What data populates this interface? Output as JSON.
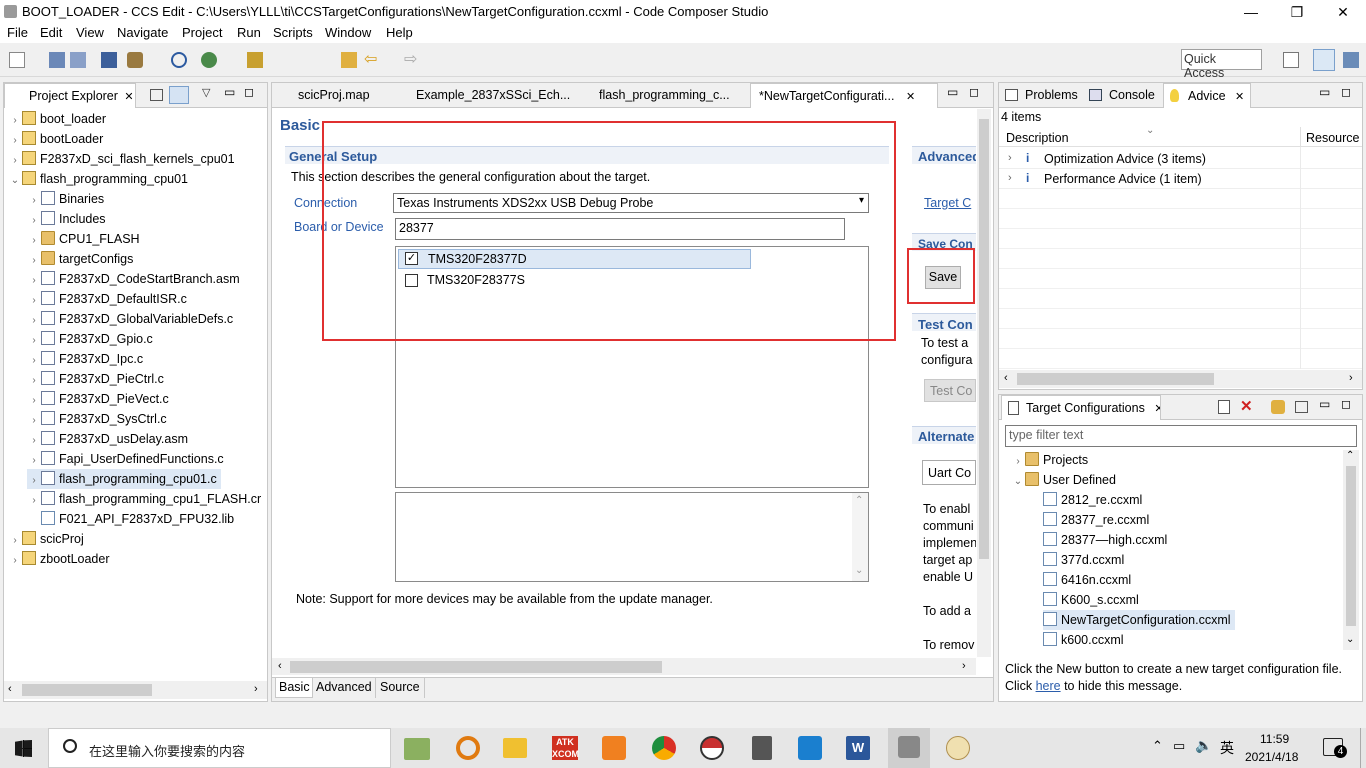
{
  "window": {
    "title": "BOOT_LOADER - CCS Edit - C:\\Users\\YLLL\\ti\\CCSTargetConfigurations\\NewTargetConfiguration.ccxml - Code Composer Studio",
    "minimize": "—",
    "restore": "❐",
    "close": "✕"
  },
  "menu": [
    "File",
    "Edit",
    "View",
    "Navigate",
    "Project",
    "Run",
    "Scripts",
    "Window",
    "Help"
  ],
  "quick_access": "Quick Access",
  "project_explorer": {
    "tab_label": "Project Explorer",
    "items": [
      {
        "label": "boot_loader",
        "level": 0,
        "twisty": "›",
        "icon": "project"
      },
      {
        "label": "bootLoader",
        "level": 0,
        "twisty": "›",
        "icon": "project"
      },
      {
        "label": "F2837xD_sci_flash_kernels_cpu01",
        "level": 0,
        "twisty": "›",
        "icon": "project"
      },
      {
        "label": "flash_programming_cpu01",
        "level": 0,
        "twisty": "⌄",
        "icon": "project"
      },
      {
        "label": "Binaries",
        "level": 1,
        "twisty": "›",
        "icon": "binaries"
      },
      {
        "label": "Includes",
        "level": 1,
        "twisty": "›",
        "icon": "includes"
      },
      {
        "label": "CPU1_FLASH",
        "level": 1,
        "twisty": "›",
        "icon": "folder"
      },
      {
        "label": "targetConfigs",
        "level": 1,
        "twisty": "›",
        "icon": "folder"
      },
      {
        "label": "F2837xD_CodeStartBranch.asm",
        "level": 1,
        "twisty": "›",
        "icon": "file"
      },
      {
        "label": "F2837xD_DefaultISR.c",
        "level": 1,
        "twisty": "›",
        "icon": "file"
      },
      {
        "label": "F2837xD_GlobalVariableDefs.c",
        "level": 1,
        "twisty": "›",
        "icon": "file"
      },
      {
        "label": "F2837xD_Gpio.c",
        "level": 1,
        "twisty": "›",
        "icon": "file"
      },
      {
        "label": "F2837xD_Ipc.c",
        "level": 1,
        "twisty": "›",
        "icon": "file"
      },
      {
        "label": "F2837xD_PieCtrl.c",
        "level": 1,
        "twisty": "›",
        "icon": "file"
      },
      {
        "label": "F2837xD_PieVect.c",
        "level": 1,
        "twisty": "›",
        "icon": "file"
      },
      {
        "label": "F2837xD_SysCtrl.c",
        "level": 1,
        "twisty": "›",
        "icon": "file"
      },
      {
        "label": "F2837xD_usDelay.asm",
        "level": 1,
        "twisty": "›",
        "icon": "file"
      },
      {
        "label": "Fapi_UserDefinedFunctions.c",
        "level": 1,
        "twisty": "›",
        "icon": "file"
      },
      {
        "label": "flash_programming_cpu01.c",
        "level": 1,
        "twisty": "›",
        "icon": "file",
        "selected": true
      },
      {
        "label": "flash_programming_cpu1_FLASH.cr",
        "level": 1,
        "twisty": "›",
        "icon": "file"
      },
      {
        "label": "F021_API_F2837xD_FPU32.lib",
        "level": 1,
        "twisty": "",
        "icon": "lib"
      },
      {
        "label": "scicProj",
        "level": 0,
        "twisty": "›",
        "icon": "project"
      },
      {
        "label": "zbootLoader",
        "level": 0,
        "twisty": "›",
        "icon": "project"
      }
    ]
  },
  "editor": {
    "tabs": [
      {
        "label": "scicProj.map",
        "active": false
      },
      {
        "label": "Example_2837xSSci_Ech...",
        "active": false
      },
      {
        "label": "flash_programming_c...",
        "active": false
      },
      {
        "label": "*NewTargetConfigurati...",
        "active": true
      }
    ],
    "heading": "Basic",
    "general_setup": {
      "title": "General Setup",
      "description": "This section describes the general configuration about the target.",
      "connection_label": "Connection",
      "connection_value": "Texas Instruments XDS2xx USB Debug Probe",
      "board_label": "Board or Device",
      "board_value": "28377",
      "devices": [
        {
          "label": "TMS320F28377D",
          "checked": true
        },
        {
          "label": "TMS320F28377S",
          "checked": false
        }
      ],
      "note": "Note: Support for more devices may be available from the update manager."
    },
    "right_column": {
      "advanced_title": "Advanced",
      "target_link": "Target C",
      "save_title": "Save Con",
      "save_button": "Save",
      "test_title": "Test Con",
      "test_text_1": "To test a",
      "test_text_2": "configura",
      "test_button": "Test Co",
      "alternate_title": "Alternate",
      "uart_button": "Uart Co",
      "enable_lines": [
        "To enabl",
        "communi",
        "implemen",
        "target ap",
        "enable U"
      ],
      "add_text": "To add a",
      "remove_text": "To remov"
    },
    "bottom_tabs": [
      "Basic",
      "Advanced",
      "Source"
    ]
  },
  "advice": {
    "tabs": [
      "Problems",
      "Console",
      "Advice"
    ],
    "count": "4 items",
    "columns": [
      "Description",
      "Resource"
    ],
    "rows": [
      "Optimization Advice (3 items)",
      "Performance Advice (1 item)"
    ]
  },
  "target_configs": {
    "tab_label": "Target Configurations",
    "filter_placeholder": "type filter text",
    "items": [
      {
        "label": "Projects",
        "level": 0,
        "twisty": "›",
        "icon": "folder"
      },
      {
        "label": "User Defined",
        "level": 0,
        "twisty": "⌄",
        "icon": "folder"
      },
      {
        "label": "2812_re.ccxml",
        "level": 1,
        "icon": "xml"
      },
      {
        "label": "28377_re.ccxml",
        "level": 1,
        "icon": "xml"
      },
      {
        "label": "28377—high.ccxml",
        "level": 1,
        "icon": "xml"
      },
      {
        "label": "377d.ccxml",
        "level": 1,
        "icon": "xml"
      },
      {
        "label": "6416n.ccxml",
        "level": 1,
        "icon": "xml"
      },
      {
        "label": "K600_s.ccxml",
        "level": 1,
        "icon": "xml"
      },
      {
        "label": "NewTargetConfiguration.ccxml",
        "level": 1,
        "icon": "xml",
        "selected": true
      },
      {
        "label": "k600.ccxml",
        "level": 1,
        "icon": "xml"
      }
    ],
    "hint_before": "Click the New button to create a new target configuration file. Click ",
    "hint_link": "here",
    "hint_after": " to hide this message."
  },
  "taskbar": {
    "search_placeholder": "在这里输入你要搜索的内容",
    "time": "11:59",
    "date": "2021/4/18",
    "ime": "英",
    "notifications": "4"
  }
}
